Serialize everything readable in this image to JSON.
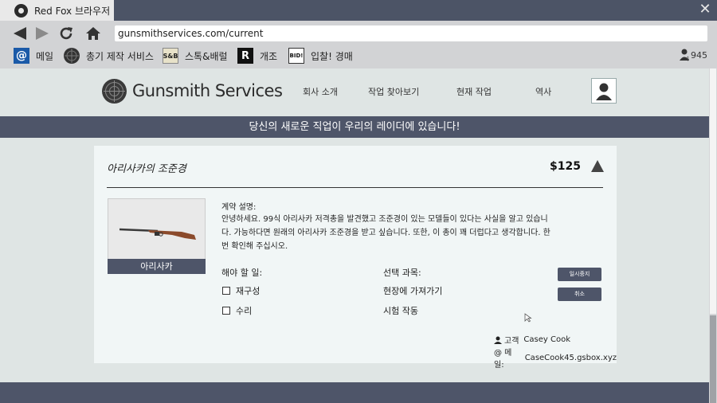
{
  "browser": {
    "tab_title": "Red Fox 브라우저",
    "url": "gunsmithservices.com/current",
    "bookmarks": [
      {
        "label": "메일",
        "icon": "mail-at-icon"
      },
      {
        "label": "총기 제작 서비스",
        "icon": "gunsmith-logo-icon"
      },
      {
        "label": "스톡&배럴",
        "icon": "stock-barrel-icon",
        "badge": "S&B"
      },
      {
        "label": "개조",
        "icon": "r-logo-icon",
        "badge": "R"
      },
      {
        "label": "입찰! 경매",
        "icon": "bid-logo-icon",
        "badge": "BID!"
      }
    ],
    "money": "945"
  },
  "site": {
    "brand": "Gunsmith Services",
    "nav": [
      "회사 소개",
      "작업 찾아보기",
      "현재 작업",
      "역사"
    ],
    "banner": "당신의 새로운 직업이 우리의 레이더에 있습니다!"
  },
  "job": {
    "title": "아리사카의 조준경",
    "price": "$125",
    "item_caption": "아리사카",
    "desc_label": "계약 설명:",
    "description": "안녕하세요. 99식 아리사카 저격총을 발견했고 조준경이 있는 모델들이 있다는 사실을 알고 있습니다. 가능하다면 원래의 아리사카 조준경을 받고 싶습니다. 또한, 이 총이 꽤 더럽다고 생각합니다. 한번 확인해 주십시오.",
    "todo_label": "해야 할 일:",
    "todos": [
      "재구성",
      "수리"
    ],
    "optional_label": "선택 과목:",
    "optionals": [
      "현장에 가져가기",
      "시험 작동"
    ],
    "buttons": {
      "pause": "일시중지",
      "cancel": "취소"
    },
    "client_label": "고객",
    "client_name": "Casey Cook",
    "mail_label": "@ 메일:",
    "mail": "CaseCook45.gsbox.xyz"
  },
  "colors": {
    "accent": "#4e5569",
    "page_bg": "#dfe5e4",
    "card_bg": "#f1f6f6"
  }
}
